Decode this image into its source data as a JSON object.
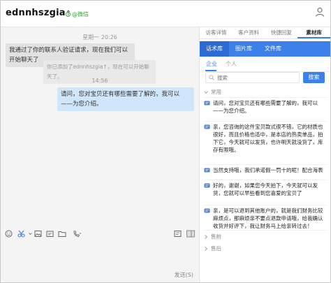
{
  "window": {
    "title": "ednnhszgia",
    "title_suffix": "↑",
    "channel_badge": "@微信"
  },
  "chat": {
    "messages": [
      {
        "type": "time",
        "text": "星期一 20:26"
      },
      {
        "type": "in",
        "text": "我通过了你的联系人验证请求，现在我们可以开始聊天了"
      },
      {
        "type": "system",
        "text": "你已添加了ednnhszgia↑，现在可以开始聊天了。"
      },
      {
        "type": "time",
        "text": "14:56"
      },
      {
        "type": "out",
        "text": "请问，您对宝贝还有哪些需要了解的，我可以——为您介绍。"
      }
    ],
    "send_label": "发送(S)"
  },
  "right": {
    "tabs": [
      "访客详情",
      "客户资料",
      "快捷回复",
      "素材库"
    ],
    "active_tab": "素材库",
    "library_tabs": [
      "话术库",
      "图片库",
      "文件库"
    ],
    "active_library_tab": "话术库",
    "sub_tabs": [
      "企业",
      "个人"
    ],
    "active_sub_tab": "企业",
    "search_placeholder": "搜索",
    "search_button": "搜索",
    "groups": [
      {
        "name": "常用",
        "expanded": true
      },
      {
        "name": "售前",
        "expanded": false
      },
      {
        "name": "售后",
        "expanded": false
      }
    ],
    "phrases": [
      "请问，您对宝贝还有哪些需要了解的，我可以——为您介绍。",
      "亲，您咨询的这件宝贝款式很不错，它的材质也很好，而且价格也适中，是本店的热卖单品，拍下它，今天就可以发货，也许明天就没货了，库存有限哦。",
      "当然支持哦，我们承诺假一罚十的呢！配合海表情",
      "好的，谢谢，如果您今天拍下，今天就可以发货，您就可以早些看到您喜爱的宝贝了",
      "亲，是可以退到其他账户的，就是我们财务比较麻烦点，那麻烦亲不要点退款申请哦，给我确认收货并好评下，我让财务马上给亲转过去！"
    ]
  },
  "colors": {
    "accent": "#3d80ea",
    "wechat_green": "#39a439",
    "out_bubble": "#cfe6fb"
  }
}
